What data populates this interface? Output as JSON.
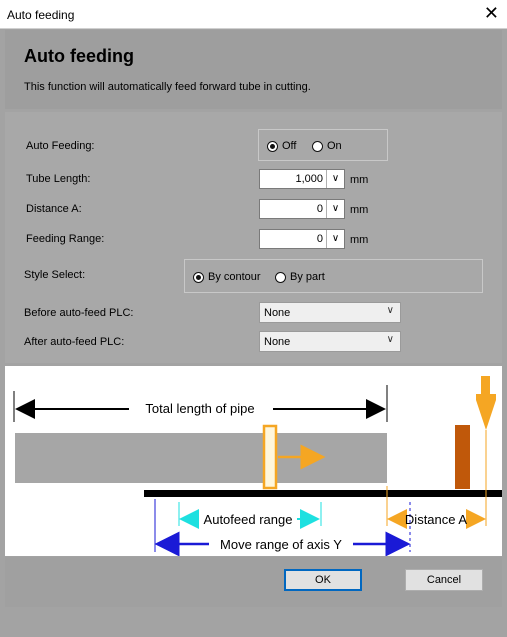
{
  "window": {
    "title": "Auto feeding",
    "close_glyph": "✕"
  },
  "header": {
    "title": "Auto feeding",
    "description": "This function will automatically feed forward tube in cutting."
  },
  "form": {
    "auto_feeding": {
      "label": "Auto Feeding:",
      "options": [
        "Off",
        "On"
      ],
      "selected": "Off"
    },
    "tube_length": {
      "label": "Tube Length:",
      "value": "1,000",
      "unit": "mm"
    },
    "distance_a": {
      "label": "Distance A:",
      "value": "0",
      "unit": "mm"
    },
    "feeding_range": {
      "label": "Feeding Range:",
      "value": "0",
      "unit": "mm"
    },
    "style_select": {
      "label": "Style Select:",
      "options": [
        "By contour",
        "By part"
      ],
      "selected": "By contour"
    },
    "before_plc": {
      "label": "Before auto-feed PLC:",
      "value": "None"
    },
    "after_plc": {
      "label": "After auto-feed PLC:",
      "value": "None"
    }
  },
  "diagram": {
    "total_length_label": "Total length of pipe",
    "autofeed_range_label": "Autofeed range",
    "distance_a_label": "Distance A",
    "move_range_label": "Move range of axis Y",
    "colors": {
      "orange": "#f5a623",
      "cyan": "#1ee0e0",
      "blue": "#1a1ad6",
      "brown": "#c0580a",
      "pipe": "#a6a6a6"
    }
  },
  "footer": {
    "ok_label": "OK",
    "cancel_label": "Cancel"
  }
}
